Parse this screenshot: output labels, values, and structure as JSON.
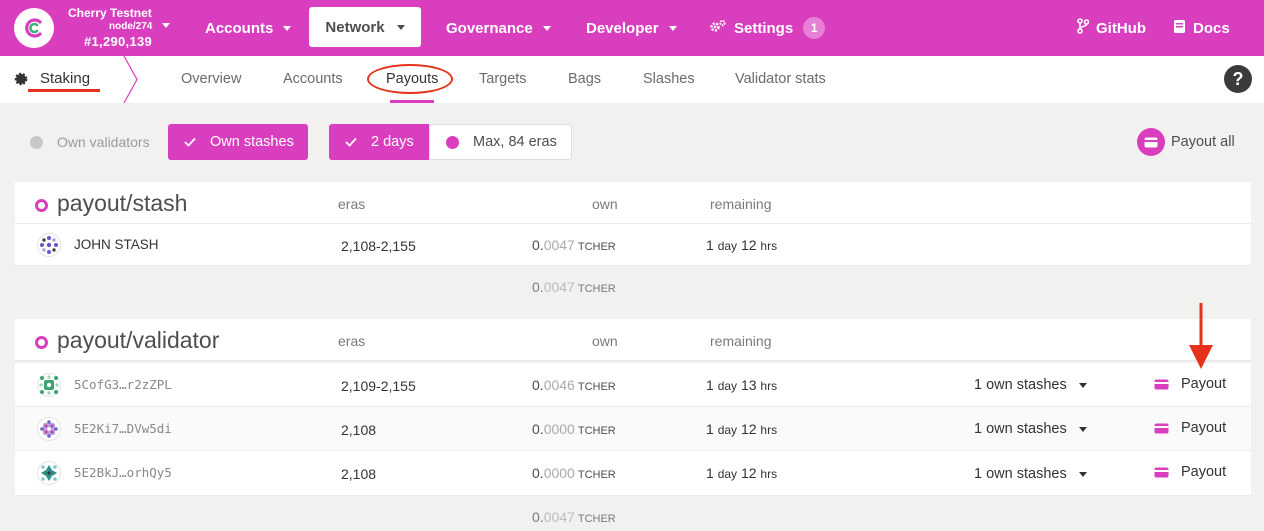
{
  "topbar": {
    "chain_name": "Cherry Testnet",
    "node": "node/274",
    "block": "#1,290,139",
    "menu": {
      "accounts": "Accounts",
      "network": "Network",
      "governance": "Governance",
      "developer": "Developer",
      "settings": "Settings",
      "settings_badge": "1",
      "github": "GitHub",
      "docs": "Docs"
    },
    "brand_color": "#d93ebf"
  },
  "subnav": {
    "section": "Staking",
    "tabs": [
      "Overview",
      "Accounts",
      "Payouts",
      "Targets",
      "Bags",
      "Slashes",
      "Validator stats"
    ],
    "active_tab": "Payouts",
    "help": "?"
  },
  "filters": {
    "own_validators": "Own validators",
    "own_stashes": "Own stashes",
    "days": "2 days",
    "max_eras": "Max, 84 eras",
    "payout_all": "Payout all"
  },
  "stash_table": {
    "title": "payout/stash",
    "columns": {
      "eras": "eras",
      "own": "own",
      "remaining": "remaining"
    },
    "rows": [
      {
        "name": "JOHN STASH",
        "eras": "2,108-2,155",
        "own_int": "0.",
        "own_dec": "0047",
        "unit": "TCHER",
        "rem_days": "1",
        "rem_day_label": "day",
        "rem_hours": "12",
        "rem_hour_label": "hrs"
      }
    ],
    "total": {
      "int": "0.",
      "dec": "0047",
      "unit": "TCHER"
    }
  },
  "validator_table": {
    "title": "payout/validator",
    "columns": {
      "eras": "eras",
      "own": "own",
      "remaining": "remaining"
    },
    "rows": [
      {
        "name": "5CofG3…r2zZPL",
        "eras": "2,109-2,155",
        "own_int": "0.",
        "own_dec": "0046",
        "unit": "TCHER",
        "rem_days": "1",
        "rem_day_label": "day",
        "rem_hours": "13",
        "rem_hour_label": "hrs",
        "stashes": "1 own stashes",
        "action": "Payout"
      },
      {
        "name": "5E2Ki7…DVw5di",
        "eras": "2,108",
        "own_int": "0.",
        "own_dec": "0000",
        "unit": "TCHER",
        "rem_days": "1",
        "rem_day_label": "day",
        "rem_hours": "12",
        "rem_hour_label": "hrs",
        "stashes": "1 own stashes",
        "action": "Payout"
      },
      {
        "name": "5E2BkJ…orhQy5",
        "eras": "2,108",
        "own_int": "0.",
        "own_dec": "0000",
        "unit": "TCHER",
        "rem_days": "1",
        "rem_day_label": "day",
        "rem_hours": "12",
        "rem_hour_label": "hrs",
        "stashes": "1 own stashes",
        "action": "Payout"
      }
    ],
    "total": {
      "int": "0.",
      "dec": "0047",
      "unit": "TCHER"
    }
  }
}
